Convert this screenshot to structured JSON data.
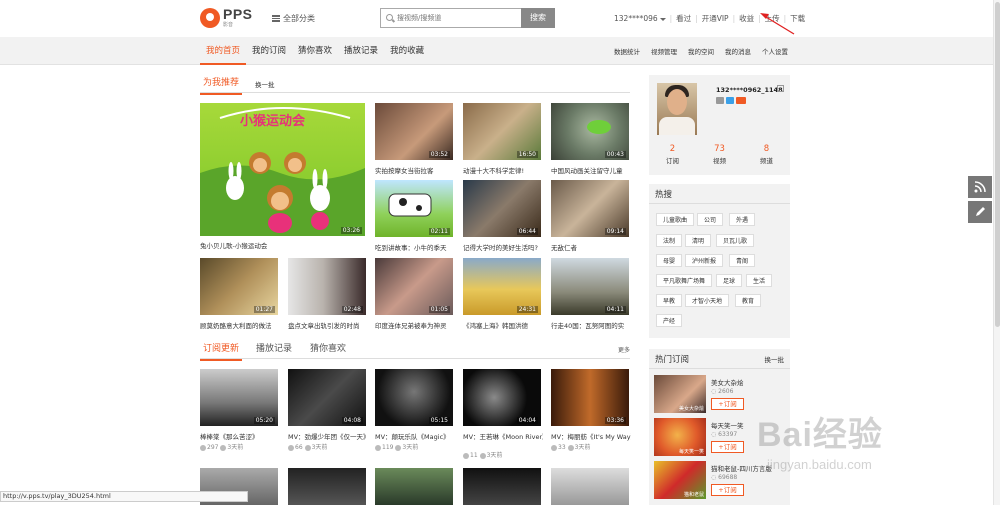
{
  "header": {
    "logo_text": "PPS",
    "logo_sub": "影音",
    "all_categories": "全部分类",
    "search_placeholder": "搜视频/搜频道",
    "search_button": "搜索",
    "user_id": "132****096",
    "links": [
      "看过",
      "开通VIP",
      "收益",
      "上传",
      "下载"
    ]
  },
  "nav": {
    "tabs": [
      "我的首页",
      "我的订阅",
      "猜你喜欢",
      "播放记录",
      "我的收藏"
    ],
    "active_tab": "我的首页",
    "right_links": [
      "数据统计",
      "视频管理",
      "我的空间",
      "我的消息",
      "个人设置"
    ]
  },
  "recommend": {
    "title": "为我推荐",
    "refresh": "换一批",
    "featured": {
      "caption": "兔小贝儿歌-小猴运动会",
      "duration": "03:26",
      "art_text": "小猴运动会"
    },
    "items": [
      {
        "caption": "实拍按摩女当街拉客",
        "duration": "03:52"
      },
      {
        "caption": "动漫十大不科学定律!",
        "duration": "16:50"
      },
      {
        "caption": "中国风动画关注留守儿童",
        "duration": "00:43"
      },
      {
        "caption": "吃到讲故事：小牛的季天",
        "duration": "02:11"
      },
      {
        "caption": "记得大学时的美好生活吗?",
        "duration": "06:44"
      },
      {
        "caption": "无敌仁者",
        "duration": "09:14"
      },
      {
        "caption": "顾莫奶酪意大利面的做法",
        "duration": "01:27"
      },
      {
        "caption": "盘点文章出轨引发的时尚",
        "duration": "02:48"
      },
      {
        "caption": "印度连体兄弟被奉为神灵",
        "duration": "01:05"
      },
      {
        "caption": "《鸿塞上海》韩国洪德",
        "duration": "24:31"
      },
      {
        "caption": "行走40国：瓦努阿图的实",
        "duration": "04:11"
      }
    ]
  },
  "updates": {
    "tabs": [
      "订阅更新",
      "播放记录",
      "猜你喜欢"
    ],
    "more": "更多",
    "items": [
      {
        "caption": "棒棒棠《那么苦涩》",
        "duration": "05:20",
        "plays": "297",
        "time": "3天前"
      },
      {
        "caption": "MV：劲爆少年团《仅一天》",
        "duration": "04:08",
        "plays": "66",
        "time": "3天前"
      },
      {
        "caption": "MV：颠玩乐队《Magic》",
        "duration": "05:15",
        "plays": "119",
        "time": "3天前"
      },
      {
        "caption": "MV：王若琳《Moon River》",
        "duration": "04:04",
        "plays": "11",
        "time": "3天前"
      },
      {
        "caption": "MV：梅丽舫《It's My Way》",
        "duration": "03:36",
        "plays": "33",
        "time": "3天前"
      }
    ]
  },
  "profile": {
    "username": "132****0962_1148",
    "stats": [
      {
        "num": "2",
        "label": "订阅"
      },
      {
        "num": "73",
        "label": "视频"
      },
      {
        "num": "8",
        "label": "频道"
      }
    ]
  },
  "hot_search": {
    "title": "热搜",
    "tags": [
      "儿童歌曲",
      "公司",
      "外遇",
      "法制",
      "清明",
      "贝瓦儿歌",
      "母婴",
      "泸州新报",
      "青阁",
      "平凡歌舞广场舞",
      "足球",
      "生活",
      "早教",
      "才智小天地",
      "教育",
      "产经"
    ]
  },
  "hot_subs": {
    "title": "热门订阅",
    "change": "换一批",
    "subscribe_label": "+订阅",
    "items": [
      {
        "name": "美女大杂烩",
        "count": "2606",
        "thumb_cap": "美女大杂烩"
      },
      {
        "name": "每天笑一笑",
        "count": "63397",
        "thumb_cap": "每天笑一笑"
      },
      {
        "name": "猫和老鼠-四川方言版",
        "count": "69688",
        "thumb_cap": "猫和老鼠"
      }
    ]
  },
  "status_url": "http://v.pps.tv/play_3DU254.html",
  "watermark": {
    "big": "Bai经验",
    "small": "jingyan.baidu.com"
  }
}
